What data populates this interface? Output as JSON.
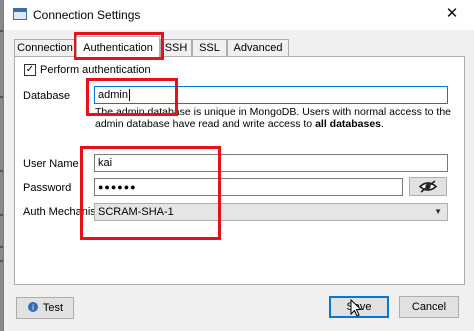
{
  "window": {
    "title": "Connection Settings",
    "close_glyph": "✕"
  },
  "tabs": [
    {
      "label": "Connection",
      "active": false
    },
    {
      "label": "Authentication",
      "active": true
    },
    {
      "label": "SSH",
      "active": false
    },
    {
      "label": "SSL",
      "active": false
    },
    {
      "label": "Advanced",
      "active": false
    }
  ],
  "auth": {
    "perform_label": "Perform authentication",
    "perform_checked": true,
    "database_label": "Database",
    "database_value": "admin",
    "hint_text": "The admin database is unique in MongoDB. Users with normal access to the admin database have read and write access to ",
    "hint_bold": "all databases",
    "hint_end": ".",
    "username_label": "User Name",
    "username_value": "kai",
    "password_label": "Password",
    "password_value": "●●●●●●",
    "mechanism_label": "Auth Mechanism",
    "mechanism_value": "SCRAM-SHA-1"
  },
  "buttons": {
    "test": "Test",
    "save": "Save",
    "cancel": "Cancel"
  },
  "icons": {
    "app": "connection-settings-icon",
    "test": "test-connection-icon",
    "reveal": "eye-icon",
    "dropdown": "chevron-down-icon"
  },
  "colors": {
    "annotation": "#e8101c",
    "focus": "#0078d7"
  }
}
